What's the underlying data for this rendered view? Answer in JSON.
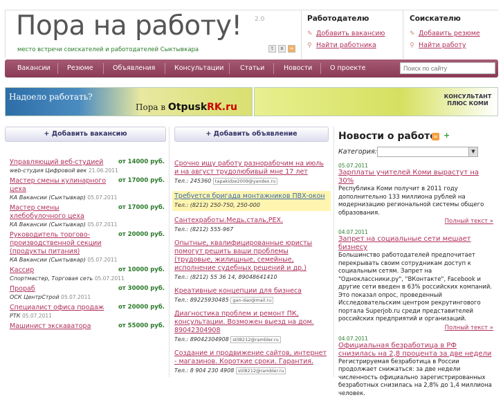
{
  "header": {
    "logo": "Пора на работу!",
    "version": "2.0",
    "tagline": "место встречи соискателей и работодателей Сыктывкара",
    "employer": {
      "title": "Работодателю",
      "links": [
        "Добавить вакансию",
        "Найти работника"
      ]
    },
    "seeker": {
      "title": "Соискателю",
      "links": [
        "Добавить резюме",
        "Найти работу"
      ]
    }
  },
  "nav": {
    "items": [
      "Вакансии",
      "Резюме",
      "Объявления",
      "Консультации",
      "Статьи",
      "Новости",
      "О проекте"
    ],
    "search_placeholder": "Поиск по сайту"
  },
  "banners": {
    "left_line1": "Надоело работать?",
    "left_line2_prefix": "Пора в ",
    "left_brand": "Otpusk",
    "left_brand_suffix": "RK.ru",
    "right_brand": "КОНСУЛЬТАНТ ПЛЮС КОМИ"
  },
  "vacancies": {
    "add_label": "+ Добавить вакансию",
    "items": [
      {
        "title": "Управляющий веб-студией",
        "salary": "от 14000 руб.",
        "company": "web-студия Цифровой век",
        "date": "21.06.2011"
      },
      {
        "title": "Мастер смены кулинарного цеха",
        "salary": "от 17000 руб.",
        "company": "КА Вакансии (Сыктывкар)",
        "date": "05.07.2011"
      },
      {
        "title": "Мастер смены хлебобулочного цеха",
        "salary": "от 17000 руб.",
        "company": "КА Вакансии (Сыктывкар)",
        "date": "05.07.2011"
      },
      {
        "title": "Руководитель торгово-производственной секции (продукты питания)",
        "salary": "от 20000 руб.",
        "company": "КА Вакансии (Сыктывкар)",
        "date": "05.07.2011"
      },
      {
        "title": "Кассир",
        "salary": "от 10000 руб.",
        "company": "Спортмастер, Торговая сеть",
        "date": "05.07.2011"
      },
      {
        "title": "Прораб",
        "salary": "от 30000 руб.",
        "company": "ОСК ЦентрСтрой",
        "date": "05.07.2011"
      },
      {
        "title": "Специалист офиса продаж",
        "salary": "от 20000 руб.",
        "company": "РТК",
        "date": "05.07.2011"
      },
      {
        "title": "Машинист экскаватора",
        "salary": "от 55000 руб.",
        "company": "",
        "date": ""
      }
    ]
  },
  "ads": {
    "add_label": "+ Добавить объявление",
    "items": [
      {
        "title": "Срочно ищу работу разнорабочим на июль и на август трудолюбивый мне 17 лет",
        "tel": "Тел.: 245360",
        "email": "tapakidze2009@yandex.ru",
        "highlight": false
      },
      {
        "title": "Требуется бригада монтажников ПВХ-окон",
        "tel": "Тел.: (8212) 250-750, 250-000",
        "email": "",
        "highlight": true
      },
      {
        "title": "Сантехработы.Медь,сталь,PEX.",
        "tel": "Тел.: (8212) 555-967",
        "email": "",
        "highlight": false
      },
      {
        "title": "Опытные, квалифицированные юристы помогут решить ваши проблемы (трудовые, жилищные, семейные, исполнение судебных решений и др.)",
        "tel": "Тел.: (8212) 55 36 14, 89048641410",
        "email": "",
        "highlight": false
      },
      {
        "title": "Креативные концепции для бизнеса",
        "tel": "Тел.: 89225930485",
        "email": "gan-dao@mail.ru",
        "highlight": false
      },
      {
        "title": "Диагностика проблем и ремонт ПК, консультации. Возможен выезд на дом. 89042304908",
        "tel": "Тел.: 89042304908",
        "email": "stil8212@rambler.ru",
        "highlight": false
      },
      {
        "title": "Создание и продвижение сайтов, интернет - магазинов. Короткие сроки. Гарантия.",
        "tel": "Тел.: 8 904 230 4908",
        "email": "stil8212@rambler.ru",
        "highlight": false
      }
    ]
  },
  "news": {
    "title": "Новости о работе",
    "category_label": "Категория:",
    "more_label": "Полный текст »",
    "items": [
      {
        "date": "05.07.2011",
        "title": "Зарплаты учителей Коми вырастут на 30%",
        "text": "Республика Коми получит в 2011 году дополнительно 133 миллиона рублей на модернизацию региональной системы общего образования."
      },
      {
        "date": "04.07.2011",
        "title": "Запрет на социальные сети мешает бизнесу",
        "text": "Большинство работодателей предпочитает перекрывать своим сотрудникам доступ к социальным сетям. Запрет на \"Одноклассники.ру\", \"ВКонтакте\", Facebook и другие сети введен в 63% российских компаний. Это показал опрос, проведенный Исследовательским центром рекрутингового портала Superjob.ru среди представителей российских предприятий и организаций."
      },
      {
        "date": "04.07.2011",
        "title": "Официальная безработица в РФ снизилась на 2,8 процента за две недели",
        "text": "Регистрируемая безработица в России продолжает снижаться: за две недели численность официально зарегистрированных безработных снизилась на 2,8% до 1,4 миллиона человек."
      }
    ]
  }
}
